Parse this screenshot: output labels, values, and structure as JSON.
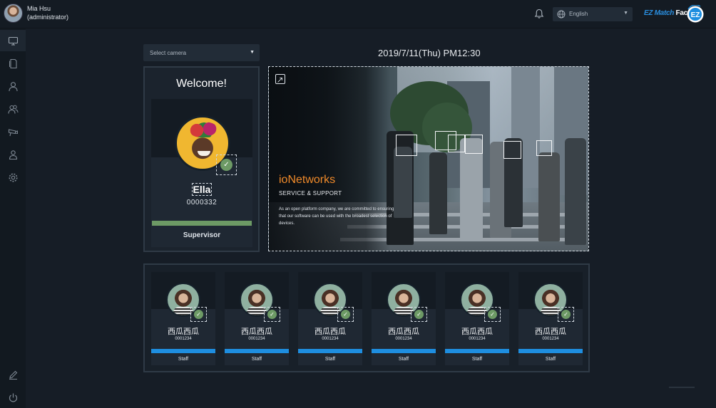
{
  "header": {
    "user_name": "Mia Hsu",
    "user_role": "(administrator)",
    "language": "English",
    "brand_prefix": "EZ Match",
    "brand_suffix": "Face",
    "brand_logo_text": "EZ"
  },
  "sidebar": {
    "items": [
      {
        "icon": "monitor-icon",
        "active": true
      },
      {
        "icon": "document-icon",
        "active": false
      },
      {
        "icon": "user-icon",
        "active": false
      },
      {
        "icon": "users-icon",
        "active": false
      },
      {
        "icon": "camera-icon",
        "active": false
      },
      {
        "icon": "user-group-icon",
        "active": false
      },
      {
        "icon": "gear-icon",
        "active": false
      }
    ],
    "bottom": [
      {
        "icon": "pencil-icon"
      },
      {
        "icon": "power-icon"
      }
    ]
  },
  "toolbar": {
    "camera_placeholder": "Select camera",
    "datetime": "2019/7/11(Thu)  PM12:30"
  },
  "welcome": {
    "title": "Welcome!",
    "name": "Ella",
    "id": "0000332",
    "role": "Supervisor",
    "role_color": "#6d9a65"
  },
  "feed": {
    "title": "ioNetworks",
    "subtitle": "SERVICE & SUPPORT",
    "text": "As an open platform company, we are committed to ensuring that our software can be used with the broadest selection of devices."
  },
  "staff": [
    {
      "name": "西瓜西瓜",
      "id": "0001234",
      "role": "Staff"
    },
    {
      "name": "西瓜西瓜",
      "id": "0001234",
      "role": "Staff"
    },
    {
      "name": "西瓜西瓜",
      "id": "0001234",
      "role": "Staff"
    },
    {
      "name": "西瓜西瓜",
      "id": "0001234",
      "role": "Staff"
    },
    {
      "name": "西瓜西瓜",
      "id": "0001234",
      "role": "Staff"
    },
    {
      "name": "西瓜西瓜",
      "id": "0001234",
      "role": "Staff"
    }
  ],
  "colors": {
    "accent_orange": "#f08a2a",
    "staff_bar": "#1e8ee0",
    "check_green": "#6d9a65",
    "background": "#161d26"
  }
}
